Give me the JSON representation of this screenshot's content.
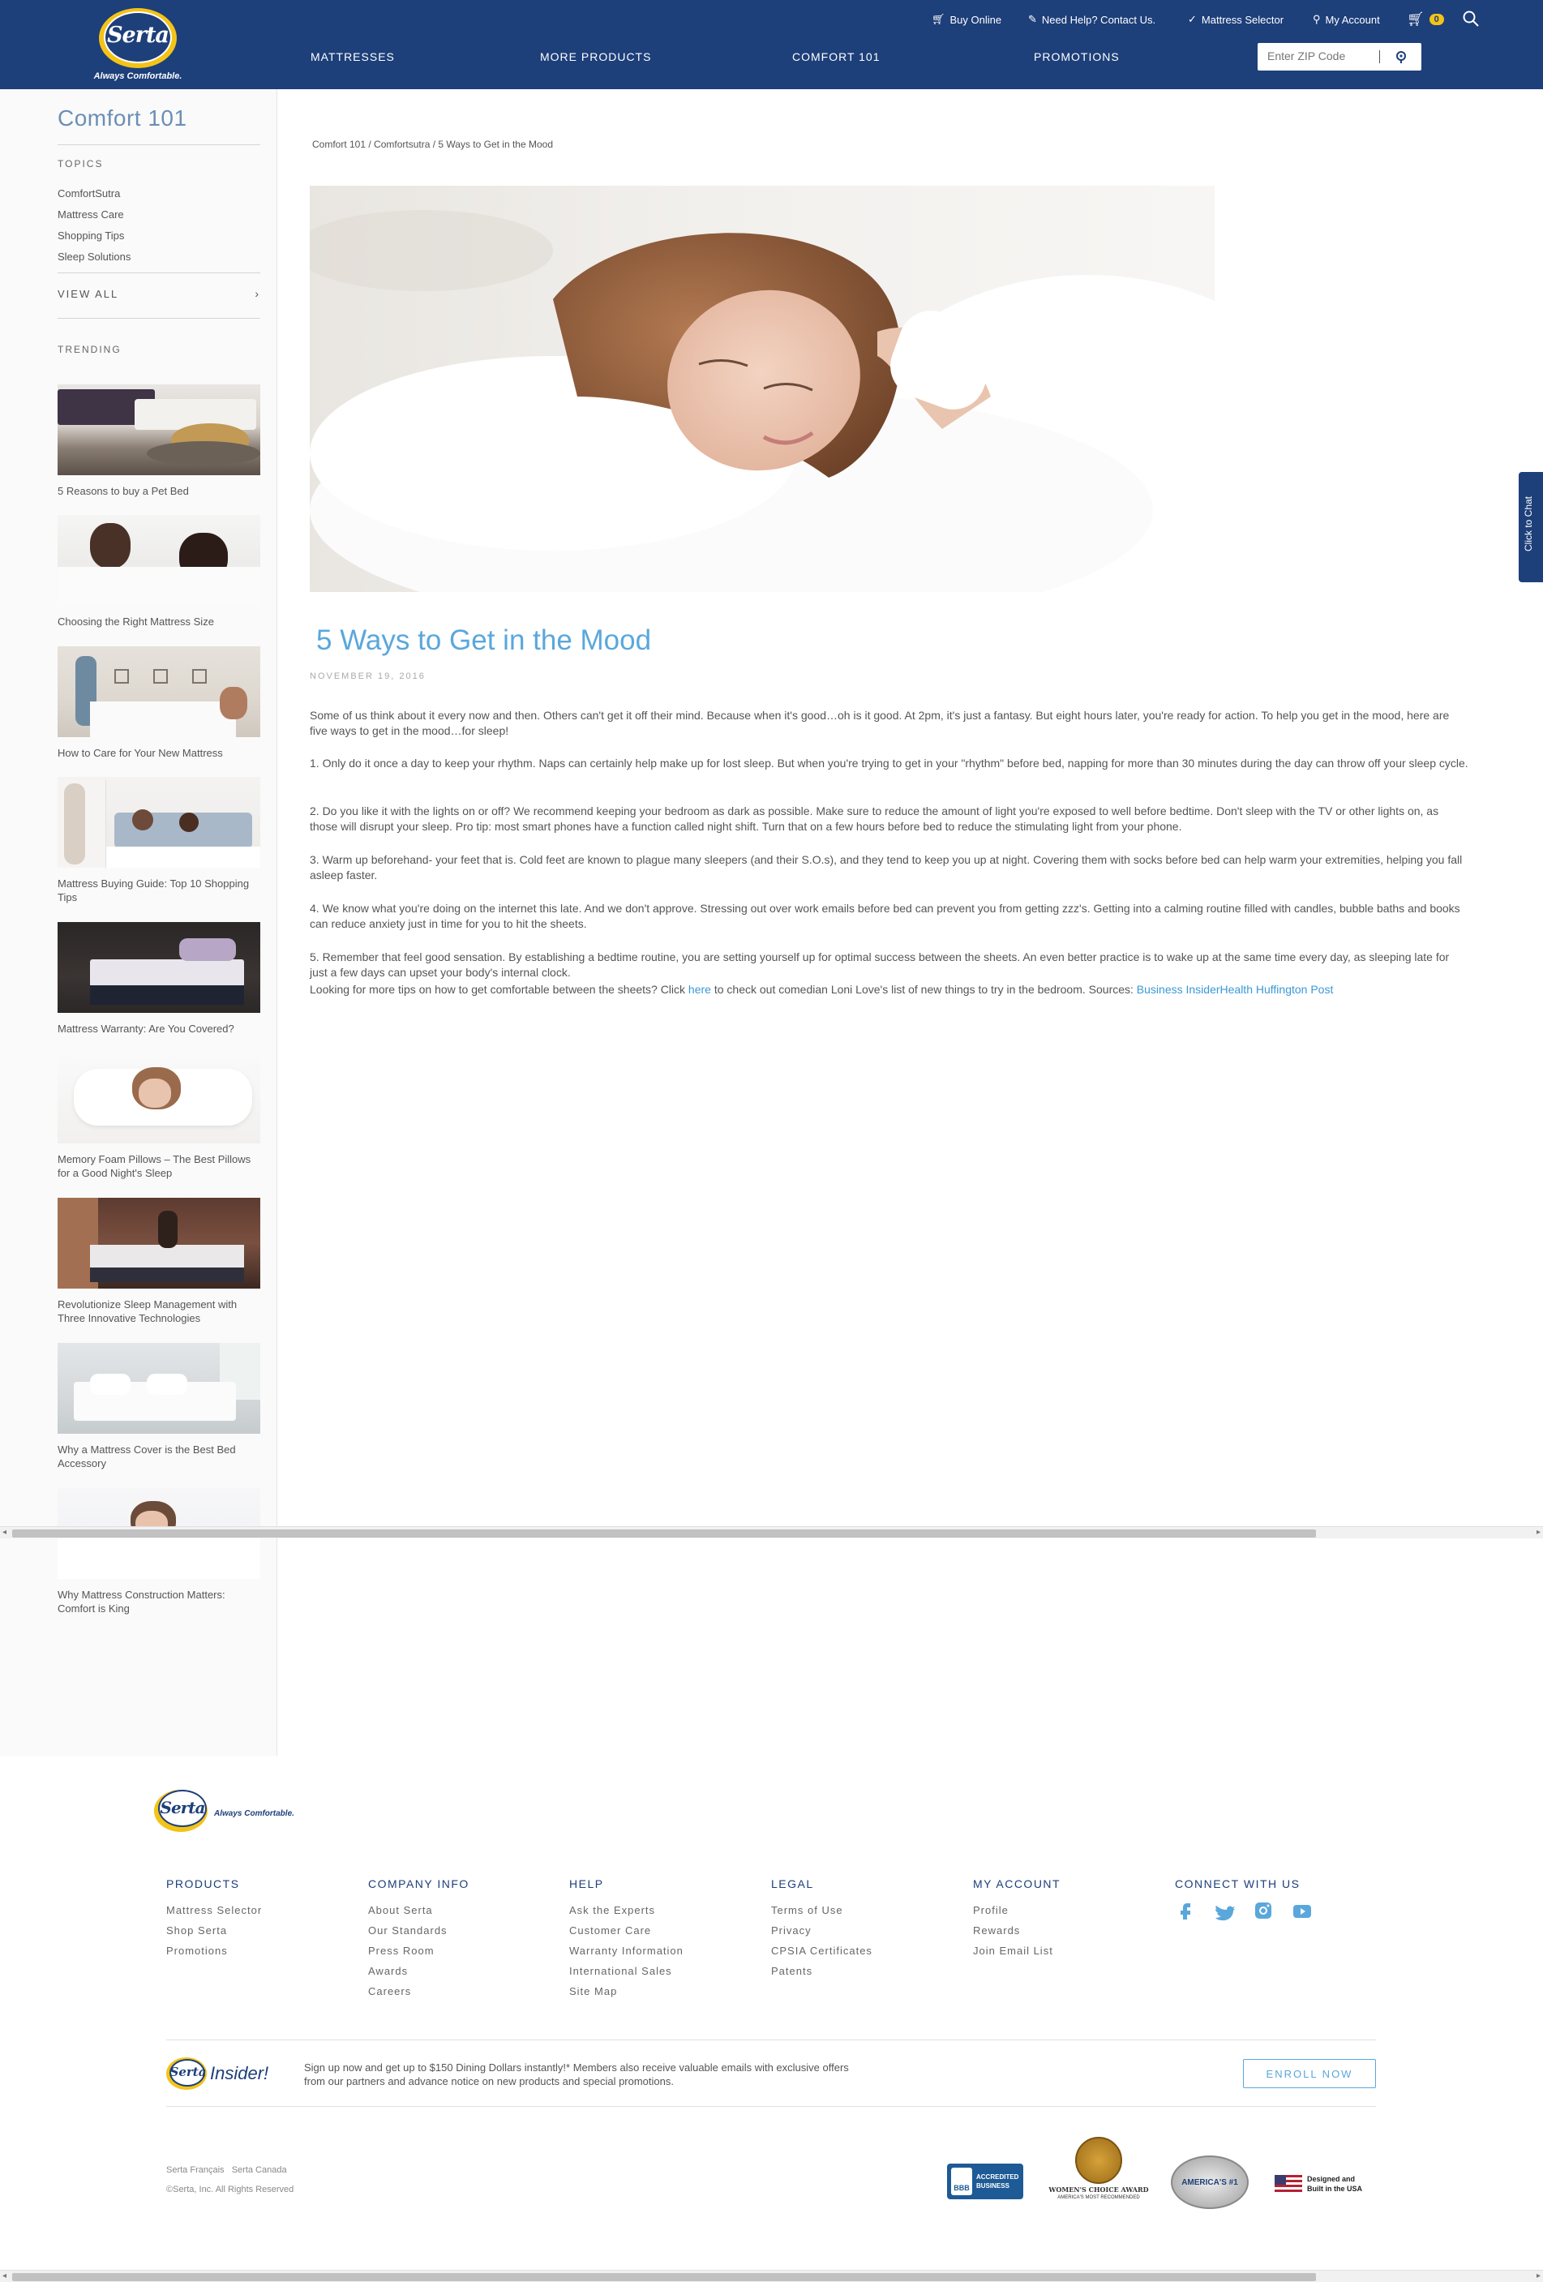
{
  "header": {
    "logo_word": "Serta",
    "logo_tagline": "Always Comfortable.",
    "utility": {
      "buy_online": "Buy Online",
      "need_help": "Need Help? Contact Us.",
      "mattress_selector": "Mattress Selector",
      "my_account": "My Account",
      "cart_count": "0"
    },
    "nav": [
      "MATTRESSES",
      "MORE PRODUCTS",
      "COMFORT 101",
      "PROMOTIONS"
    ],
    "zip_placeholder": "Enter ZIP Code"
  },
  "sidebar": {
    "title": "Comfort 101",
    "topics_heading": "TOPICS",
    "topics": [
      "ComfortSutra",
      "Mattress Care",
      "Shopping Tips",
      "Sleep Solutions"
    ],
    "view_all": "VIEW ALL",
    "trending_heading": "TRENDING",
    "trending": [
      "5 Reasons to buy a Pet Bed",
      "Choosing the Right Mattress Size",
      "How to Care for Your New Mattress",
      "Mattress Buying Guide: Top 10 Shopping Tips",
      "Mattress Warranty: Are You Covered?",
      "Memory Foam Pillows – The Best Pillows for a Good Night's Sleep",
      "Revolutionize Sleep Management with Three Innovative Technologies",
      "Why a Mattress Cover is the Best Bed Accessory",
      "Why Mattress Construction Matters: Comfort is King"
    ]
  },
  "article": {
    "breadcrumb": "Comfort 101 / Comfortsutra /  5 Ways to Get in the Mood",
    "title": "5 Ways to Get in the Mood",
    "date": "NOVEMBER 19, 2016",
    "intro": "Some of us think about it every now and then. Others can't get it off their mind. Because when it's good…oh is it good. At 2pm, it's just a fantasy. But eight hours later, you're ready for action. To help you get in the mood, here are five ways to get in the mood…for sleep!",
    "p1": "1. Only do it once a day to keep your rhythm. Naps can certainly help make up for lost sleep. But when you're trying to get in your \"rhythm\" before bed, napping for more than 30 minutes during the day can throw off your sleep cycle.",
    "p2": "2. Do you like it with the lights on or off? We recommend keeping your bedroom as dark as possible. Make sure to reduce the amount of light you're exposed to well before bedtime. Don't sleep with the TV or other lights on, as those will disrupt your sleep. Pro tip: most smart phones have a function called night shift. Turn that on a few hours before bed to reduce the stimulating light from your phone.",
    "p3": "3. Warm up beforehand- your feet that is. Cold feet are known to plague many sleepers (and their S.O.s), and they tend to keep you up at night. Covering them with socks before bed can help warm your extremities, helping you fall asleep faster.",
    "p4": "4. We know what you're doing on the internet this late. And we don't approve. Stressing out over work emails before bed can prevent you from getting zzz's. Getting into a calming routine filled with candles, bubble baths and books can reduce anxiety just in time for you to hit the sheets.",
    "p5": "5. Remember that feel good sensation. By establishing a bedtime routine, you are setting yourself up for optimal success between the sheets. An even better practice is to wake up at the same time every day, as sleeping late for just a few days can upset your body's internal clock.",
    "p6_before": "Looking for more tips on how to get comfortable between the sheets? Click ",
    "p6_link": "here",
    "p6_middle": " to check out comedian Loni Love's list of new things to try in the bedroom. Sources: ",
    "p6_source1": "Business Insider",
    "p6_source2": "Health",
    "p6_source3": " Huffington Post"
  },
  "chat_tab": "Click to Chat",
  "footer": {
    "logo_tagline": "Always Comfortable.",
    "columns": [
      {
        "heading": "PRODUCTS",
        "links": [
          "Mattress Selector",
          "Shop Serta",
          "Promotions"
        ]
      },
      {
        "heading": "COMPANY INFO",
        "links": [
          "About Serta",
          "Our Standards",
          "Press Room",
          "Awards",
          "Careers"
        ]
      },
      {
        "heading": "HELP",
        "links": [
          "Ask the Experts",
          "Customer Care",
          "Warranty Information",
          "International Sales",
          "Site Map"
        ]
      },
      {
        "heading": "LEGAL",
        "links": [
          "Terms of Use",
          "Privacy",
          "CPSIA Certificates",
          "Patents"
        ]
      },
      {
        "heading": "MY ACCOUNT",
        "links": [
          "Profile",
          "Rewards",
          "Join Email List"
        ]
      }
    ],
    "connect_heading": "CONNECT WITH US",
    "social_icons": [
      "facebook-icon",
      "twitter-icon",
      "instagram-icon",
      "youtube-icon"
    ],
    "insider_word": "Insider!",
    "insider_text": "Sign up now and get up to $150 Dining Dollars instantly!* Members also receive valuable emails with exclusive offers from our partners and advance notice on new products and special promotions.",
    "enroll_button": "ENROLL NOW",
    "lang_links": [
      "Serta Français",
      "Serta Canada"
    ],
    "copyright": "©Serta, Inc. All Rights Reserved",
    "badges": {
      "bbb_line1": "ACCREDITED",
      "bbb_line2": "BUSINESS",
      "womens_choice": "WOMEN'S CHOICE AWARD",
      "womens_choice_sub": "AMERICA'S MOST RECOMMENDED",
      "americas_number1": "AMERICA'S #1",
      "made_usa_line1": "Designed and",
      "made_usa_line2": "Built in the USA"
    }
  },
  "colors": {
    "brand_navy": "#1d3f7a",
    "brand_yellow": "#f3c318",
    "link_blue": "#3a99d8"
  }
}
